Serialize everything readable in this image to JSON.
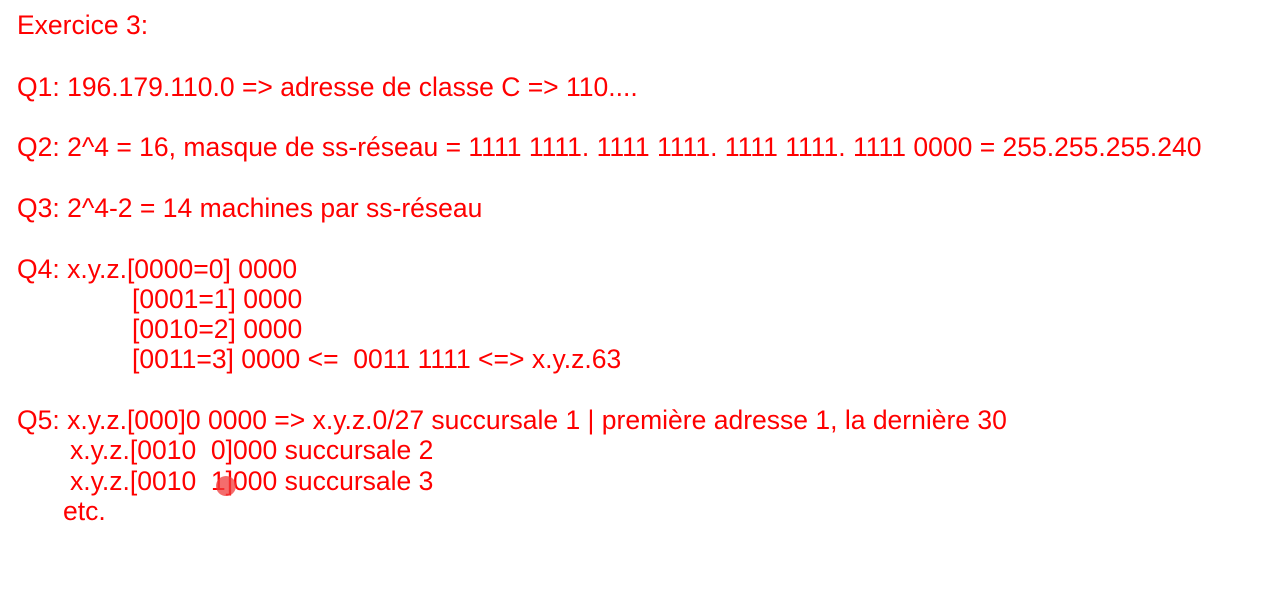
{
  "title": "Exercice 3:",
  "q1": "Q1: 196.179.110.0 => adresse de classe C => 110....",
  "q2": "Q2: 2^4 = 16, masque de ss-réseau = 1111 1111. 1111 1111. 1111 1111. 1111 0000 = 255.255.255.240",
  "q3": "Q3: 2^4-2 = 14 machines par ss-réseau",
  "q4": [
    "Q4: x.y.z.[0000=0] 0000",
    "[0001=1] 0000",
    "[0010=2] 0000",
    "[0011=3] 0000 <=  0011 1111 <=> x.y.z.63"
  ],
  "q5": [
    "Q5: x.y.z.[000]0 0000 => x.y.z.0/27 succursale 1 | première adresse 1, la dernière 30",
    "x.y.z.[0010  0]000 succursale 2",
    "x.y.z.[0010  1]000 succursale 3",
    "etc."
  ],
  "colors": {
    "text": "#ff0000",
    "cursor": "#f03c3c"
  }
}
